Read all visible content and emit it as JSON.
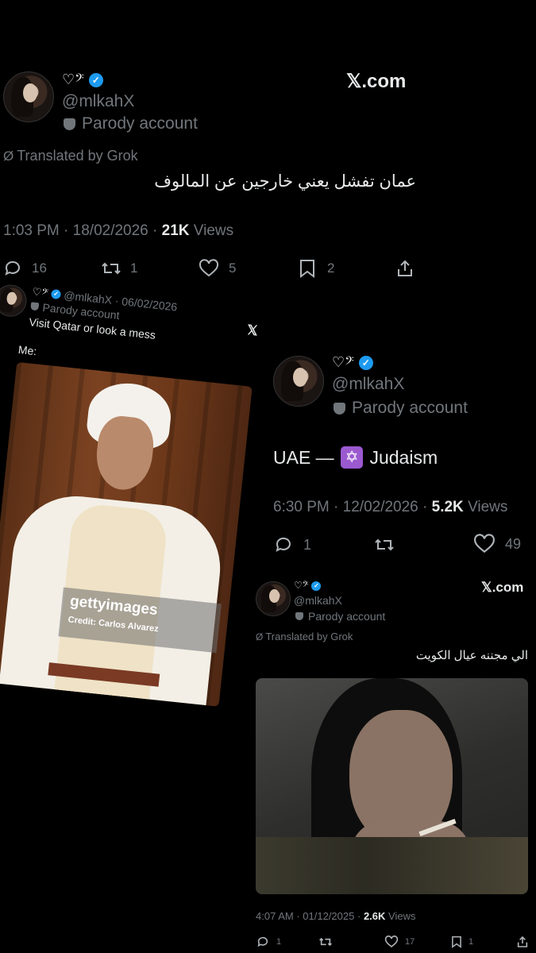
{
  "tweet1": {
    "glyph": "♡𝄢",
    "username": "@mlkahX",
    "parody": "Parody account",
    "brand": "𝕏.com",
    "translated": "Translated by Grok",
    "text": "عمان تفشل يعني خارجين عن المالوف",
    "time": "1:03 PM",
    "date": "18/02/2026",
    "views_count": "21K",
    "views_label": "Views",
    "replies": "16",
    "reposts": "1",
    "likes": "5",
    "bookmarks": "2"
  },
  "tweet2": {
    "glyph": "♡𝄢",
    "meta": "@mlkahX · 06/02/2026",
    "parody": "Parody account",
    "text": "Visit Qatar or look a mess",
    "me": "Me:",
    "x_logo": "𝕏",
    "photo_brand": "gettyimages",
    "photo_credit": "Credit: Carlos Alvarez"
  },
  "tweet3": {
    "glyph": "♡𝄢",
    "username": "@mlkahX",
    "parody": "Parody account",
    "text_pre": "UAE — ",
    "emoji": "✡",
    "text_post": " Judaism",
    "time": "6:30 PM",
    "date": "12/02/2026",
    "views_count": "5.2K",
    "views_label": "Views",
    "replies": "1",
    "likes": "49"
  },
  "tweet4": {
    "glyph": "♡𝄢",
    "username": "@mlkahX",
    "parody": "Parody account",
    "brand": "𝕏.com",
    "translated": "Translated by Grok",
    "text": "الي مجننه عيال الكويت",
    "time": "4:07 AM",
    "date": "01/12/2025",
    "views_count": "2.6K",
    "views_label": "Views",
    "replies": "1",
    "likes": "17",
    "bookmarks": "1"
  }
}
